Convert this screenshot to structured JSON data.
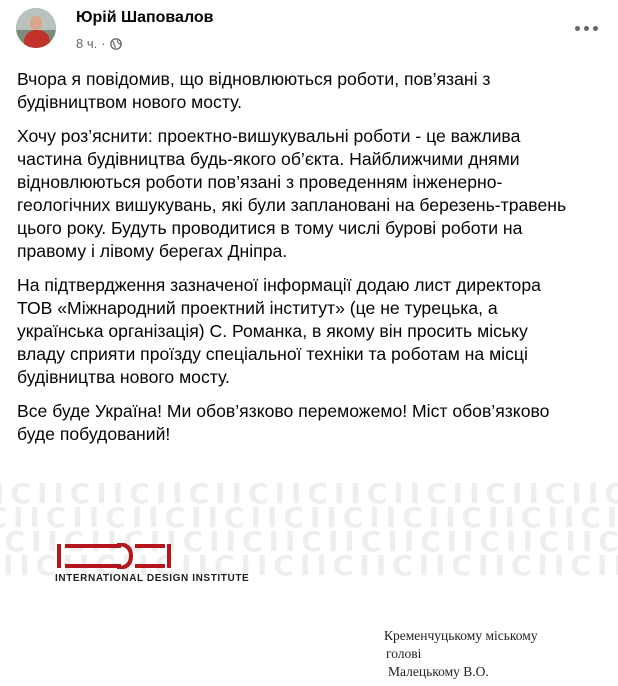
{
  "post": {
    "author": "Юрій Шаповалов",
    "time": "8 ч.",
    "separator": "·",
    "paragraphs": [
      "Вчора я повідомив, що відновлюються роботи, пов’язані з\nбудівництвом нового мосту.",
      "Хочу роз’яснити: проектно-вишукувальні роботи - це важлива\nчастина будівництва будь-якого об’єкта. Найближчими днями\nвідновлюються роботи пов’язані з проведенням інженерно-\nгеологічних вишукувань, які були заплановані на березень-травень\nцього року. Будуть  проводитися в тому числі бурові роботи на\nправому і лівому берегах Дніпра.",
      "На підтвердження зазначеної інформації додаю лист директора\nТОВ «Міжнародний проектний інститут» (це не турецька, а\nукраїнська організація) С. Романка, в якому він просить міську\nвладу сприяти проїзду спеціальної техніки та роботам на місці\nбудівництва нового мосту.",
      "Все буде Україна! Ми обов’язково переможемо! Міст обов’язково\nбуде побудований!"
    ]
  },
  "attachment": {
    "logo_caption": "INTERNATIONAL DESIGN INSTITUTE",
    "addressee_lines": [
      "Кременчуцькому міському",
      "голові",
      "Малецькому В.О."
    ]
  },
  "icons": {
    "privacy": "globe-icon",
    "menu": "more-options-icon"
  },
  "colors": {
    "logo_red": "#b5161e",
    "meta_gray": "#65676b"
  }
}
